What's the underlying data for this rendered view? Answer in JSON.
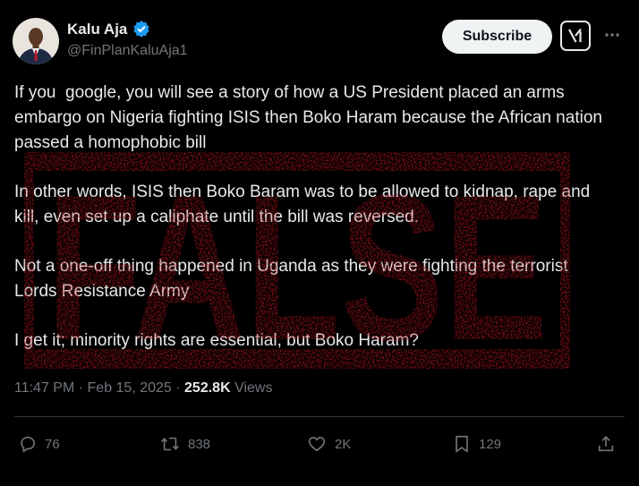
{
  "author": {
    "display_name": "Kalu Aja",
    "handle": "@FinPlanKaluAja1",
    "verified_icon": "verified-badge-icon"
  },
  "header": {
    "subscribe_label": "Subscribe",
    "grok_icon": "grok-icon",
    "more_icon": "more-icon"
  },
  "post": {
    "paragraphs": [
      "If you  google, you will see a story of how a US President placed an arms embargo on Nigeria fighting ISIS then Boko Haram because the African nation passed a homophobic bill",
      "In other words, ISIS then Boko Baram was to be allowed to kidnap, rape and kill, even set up a caliphate until the bill was reversed.",
      "Not a one-off thing happened in Uganda as they were fighting the terrorist Lords Resistance Army",
      "I get it; minority rights are essential, but Boko Haram?"
    ],
    "time": "11:47 PM",
    "separator": " · ",
    "date": "Feb 15, 2025",
    "views_count": "252.8K",
    "views_label": " Views"
  },
  "stamp": {
    "text": "FALSE",
    "color": "#a3141e"
  },
  "actions": {
    "replies": "76",
    "reposts": "838",
    "likes": "2K",
    "bookmarks": "129"
  },
  "colors": {
    "background": "#000000",
    "text": "#e7e9ea",
    "secondary": "#71767b",
    "verified": "#1d9bf0"
  }
}
